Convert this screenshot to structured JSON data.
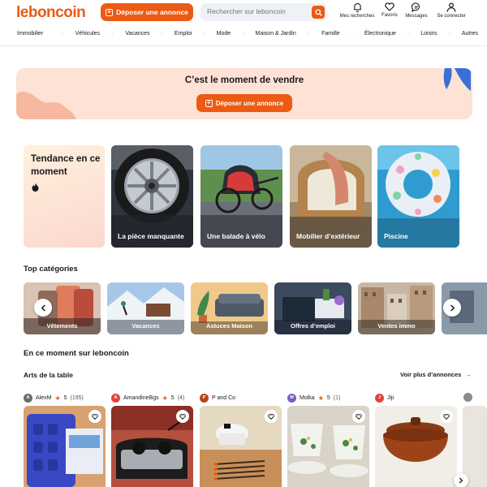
{
  "header": {
    "logo": "leboncoin",
    "post_label": "Déposer une annonce",
    "search_placeholder": "Rechercher sur leboncoin",
    "icons": [
      {
        "name": "bell-icon",
        "label": "Mes recherches"
      },
      {
        "name": "heart-icon",
        "label": "Favoris"
      },
      {
        "name": "message-icon",
        "label": "Messages"
      },
      {
        "name": "user-icon",
        "label": "Se connecter"
      }
    ]
  },
  "categories": [
    "Immobilier",
    "Véhicules",
    "Vacances",
    "Emploi",
    "Mode",
    "Maison & Jardin",
    "Famille",
    "Électronique",
    "Loisirs",
    "Autres"
  ],
  "banner": {
    "title": "C’est le moment de vendre",
    "button": "Déposer une annonce"
  },
  "trends": {
    "title": "Tendance en ce moment",
    "icon": "flame-icon",
    "cards": [
      "La pièce manquante",
      "Une balade à vélo",
      "Mobilier d’extérieur",
      "Piscine"
    ]
  },
  "top_categories": {
    "title": "Top catégories",
    "items": [
      "Vêtements",
      "Vacances",
      "Astuces Maison",
      "Offres d’emploi",
      "Ventes immo"
    ]
  },
  "moment": {
    "title": "En ce moment sur leboncoin",
    "subtitle": "Arts de la table",
    "see_more": "Voir plus d’annonces",
    "sellers": [
      {
        "initial": "A",
        "name": "AlexM",
        "rating": "5",
        "count": "(195)",
        "color": "#6b6b6b"
      },
      {
        "initial": "A",
        "name": "AmandineBgs",
        "rating": "5",
        "count": "(4)",
        "color": "#e0453b"
      },
      {
        "initial": "P",
        "name": "P and Co",
        "rating": "",
        "count": "",
        "color": "#b5451b"
      },
      {
        "initial": "M",
        "name": "Molka",
        "rating": "5",
        "count": "(1)",
        "color": "#7b5cc4"
      },
      {
        "initial": "J",
        "name": "Jiji",
        "rating": "",
        "count": "",
        "color": "#e0453b"
      }
    ]
  },
  "colors": {
    "brand": "#ec5a13",
    "banner_bg": "#fde2d5"
  }
}
